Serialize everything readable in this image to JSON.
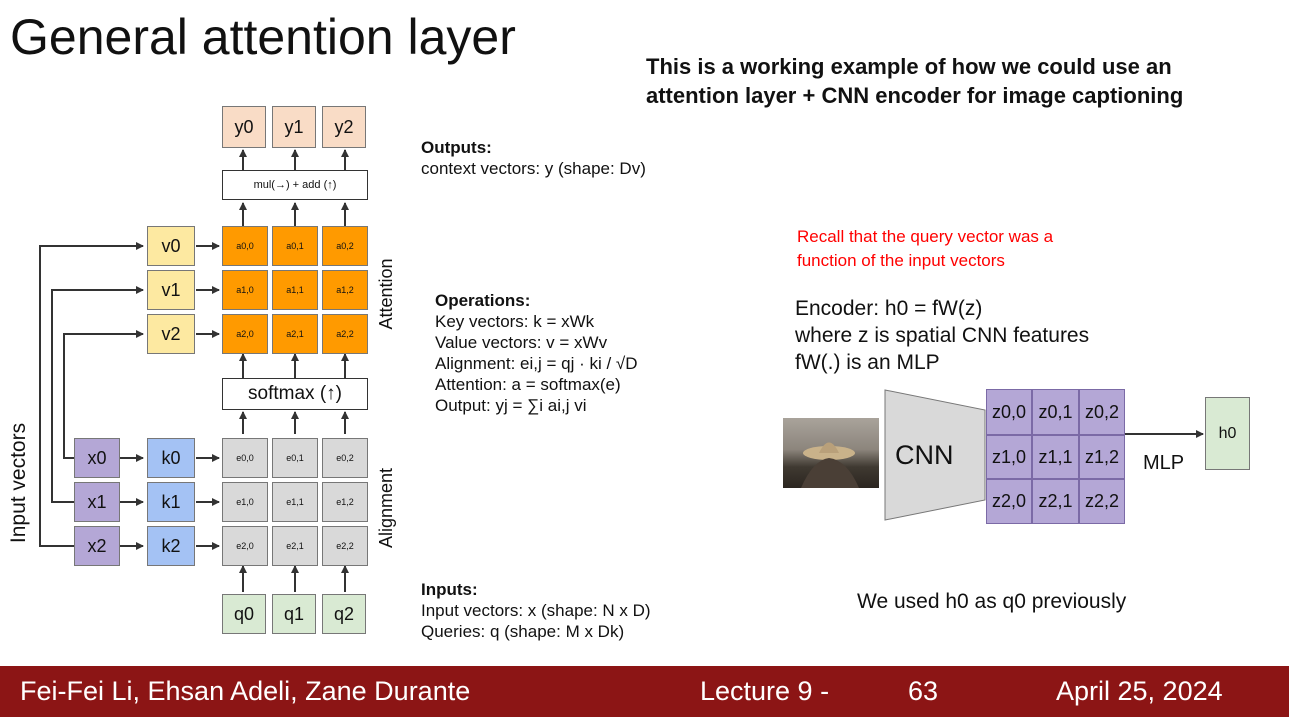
{
  "slide": {
    "title": "General attention layer",
    "subtitle_line1": "This is a working example of how we could use an",
    "subtitle_line2": "attention layer + CNN encoder for image captioning"
  },
  "diagram": {
    "outputs": [
      "y0",
      "y1",
      "y2"
    ],
    "mul_add_label": "mul(→) + add (↑)",
    "values": [
      "v0",
      "v1",
      "v2"
    ],
    "attention_cells": [
      [
        "a0,0",
        "a0,1",
        "a0,2"
      ],
      [
        "a1,0",
        "a1,1",
        "a1,2"
      ],
      [
        "a2,0",
        "a2,1",
        "a2,2"
      ]
    ],
    "softmax_label": "softmax (↑)",
    "inputs": [
      "x0",
      "x1",
      "x2"
    ],
    "keys": [
      "k0",
      "k1",
      "k2"
    ],
    "alignment_cells": [
      [
        "e0,0",
        "e0,1",
        "e0,2"
      ],
      [
        "e1,0",
        "e1,1",
        "e1,2"
      ],
      [
        "e2,0",
        "e2,1",
        "e2,2"
      ]
    ],
    "queries": [
      "q0",
      "q1",
      "q2"
    ],
    "attention_label": "Attention",
    "alignment_label": "Alignment",
    "input_vectors_label": "Input vectors"
  },
  "outputs_text": {
    "heading": "Outputs:",
    "line": "context vectors: y (shape: Dv)"
  },
  "operations_text": {
    "heading": "Operations:",
    "key": "Key vectors: k = xWk",
    "value": "Value vectors: v = xWv",
    "alignment": "Alignment: ei,j = qj · ki / √D",
    "attention": "Attention: a = softmax(e)",
    "output": "Output: yj = ∑i ai,j vi"
  },
  "inputs_text": {
    "heading": "Inputs:",
    "line1": "Input vectors: x (shape: N x D)",
    "line2": "Queries: q (shape: M x Dk)"
  },
  "encoder": {
    "recall_line1": "Recall that the query vector was a",
    "recall_line2": "function of the input vectors",
    "recall_color": "#ff0000",
    "line1": "Encoder: h0 = fW(z)",
    "line2": "where z is spatial CNN features",
    "line3": "fW(.) is an MLP",
    "cnn_label": "CNN",
    "z_cells": [
      [
        "z0,0",
        "z0,1",
        "z0,2"
      ],
      [
        "z1,0",
        "z1,1",
        "z1,2"
      ],
      [
        "z2,0",
        "z2,1",
        "z2,2"
      ]
    ],
    "mlp_label": "MLP",
    "h0_label": "h0",
    "note": "We used h0 as q0 previously"
  },
  "footer": {
    "authors": "Fei-Fei Li, Ehsan Adeli, Zane Durante",
    "lecture": "Lecture 9 -",
    "page": "63",
    "date": "April 25, 2024",
    "color": "#8c1515"
  }
}
